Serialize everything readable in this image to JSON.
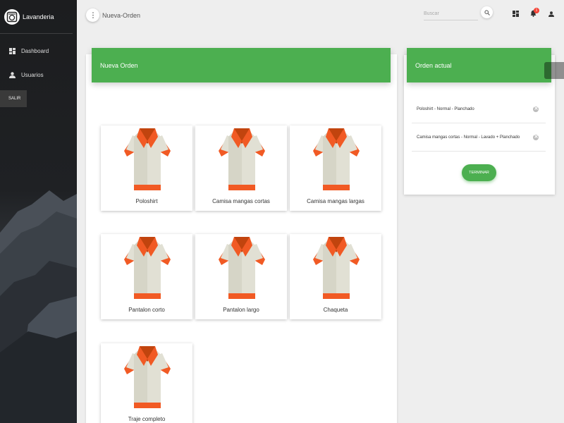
{
  "sidebar": {
    "brand_title": "Lavanderia",
    "items": [
      {
        "label": "Dashboard",
        "icon": "dashboard-icon"
      },
      {
        "label": "Usuarios",
        "icon": "person-icon"
      }
    ],
    "logout_label": "SALIR"
  },
  "topbar": {
    "title": "Nueva-Orden",
    "search_placeholder": "Buscar",
    "notifications_count": "1"
  },
  "main": {
    "header": "Nueva Orden",
    "products": [
      {
        "name": "Poloshirt"
      },
      {
        "name": "Camisa mangas cortas"
      },
      {
        "name": "Camisa mangas largas"
      },
      {
        "name": "Pantalon corto"
      },
      {
        "name": "Pantalon largo"
      },
      {
        "name": "Chaqueta"
      },
      {
        "name": "Traje completo"
      }
    ]
  },
  "order": {
    "header": "Orden actual",
    "items": [
      {
        "label": "Poloshirt - Normal - Planchado"
      },
      {
        "label": "Camisa mangas cortas - Normal - Lavado + Planchado"
      }
    ],
    "finish_label": "TERMINAR"
  },
  "colors": {
    "accent": "#4caf50",
    "shirt_body": "#e1e0d4",
    "shirt_trim": "#f15a24",
    "badge": "#f44336"
  }
}
